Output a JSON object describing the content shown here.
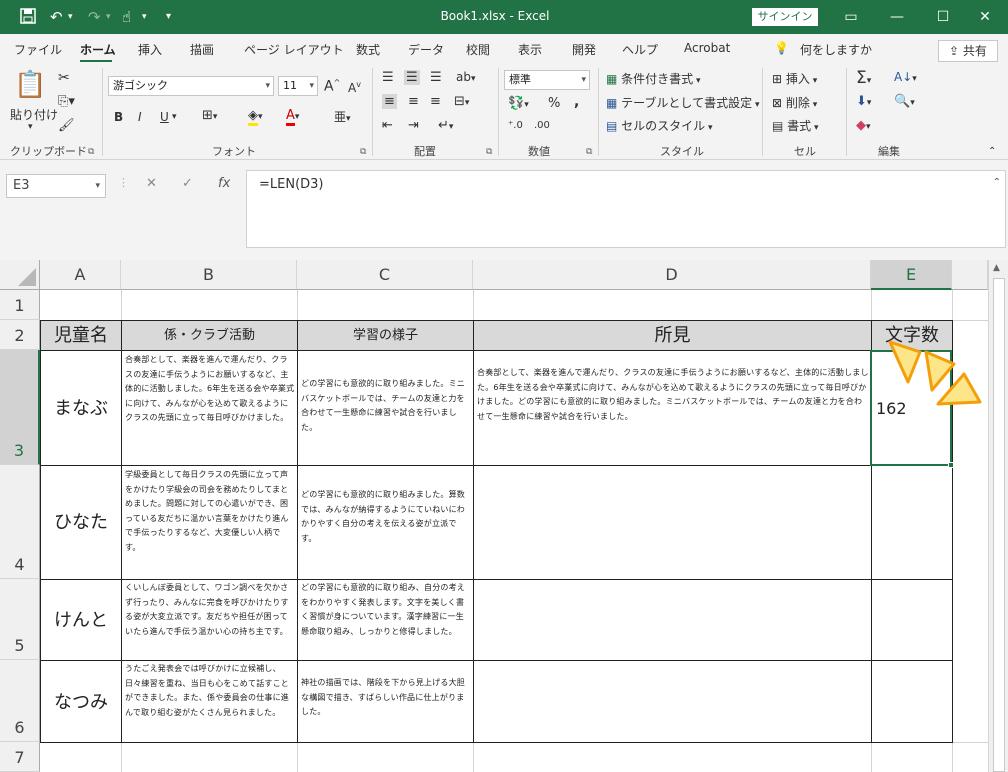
{
  "titlebar": {
    "title": "Book1.xlsx  -  Excel",
    "signin": "サインイン",
    "save_icon": "save-icon",
    "undo_icon": "undo-icon",
    "redo_icon": "redo-icon",
    "touch_icon": "touch-mode-icon"
  },
  "menu": {
    "tabs": [
      "ファイル",
      "ホーム",
      "挿入",
      "描画",
      "ページ レイアウト",
      "数式",
      "データ",
      "校閲",
      "表示",
      "開発",
      "ヘルプ",
      "Acrobat"
    ],
    "search": "何をしますか",
    "share": "共有"
  },
  "ribbon": {
    "clipboard": {
      "paste": "貼り付け",
      "label": "クリップボード"
    },
    "font": {
      "name": "游ゴシック",
      "size": "11",
      "label": "フォント",
      "grow": "A",
      "shrink": "A",
      "bold": "B",
      "italic": "I",
      "underline": "U"
    },
    "alignment": {
      "label": "配置"
    },
    "number": {
      "format": "標準",
      "label": "数値",
      "percent": "%",
      "comma": ","
    },
    "styles": {
      "conditional": "条件付き書式",
      "table": "テーブルとして書式設定",
      "cell": "セルのスタイル",
      "label": "スタイル"
    },
    "cells": {
      "insert": "挿入",
      "delete": "削除",
      "format": "書式",
      "label": "セル"
    },
    "editing": {
      "label": "編集"
    }
  },
  "formula_bar": {
    "namebox": "E3",
    "formula": "=LEN(D3)",
    "fx": "fx"
  },
  "sheet": {
    "columns": [
      "A",
      "B",
      "C",
      "D",
      "E"
    ],
    "rows": [
      "1",
      "2",
      "3",
      "4",
      "5",
      "6",
      "7"
    ],
    "headers": {
      "a": "児童名",
      "b": "係・クラブ活動",
      "c": "学習の様子",
      "d": "所見",
      "e": "文字数"
    },
    "records": [
      {
        "name": "まなぶ",
        "club": "合奏部として、楽器を進んで運んだり、クラスの友達に手伝うようにお願いするなど、主体的に活動しました。6年生を送る会や卒業式に向けて、みんなが心を込めて歌えるようにクラスの先頭に立って毎日呼びかけました。",
        "study": "どの学習にも意欲的に取り組みました。ミニバスケットボールでは、チームの友達と力を合わせて一生懸命に練習や試合を行いました。",
        "remark": "合奏部として、楽器を進んで運んだり、クラスの友達に手伝うようにお願いするなど、主体的に活動しました。6年生を送る会や卒業式に向けて、みんなが心を込めて歌えるようにクラスの先頭に立って毎日呼びかけました。どの学習にも意欲的に取り組みました。ミニバスケットボールでは、チームの友達と力を合わせて一生懸命に練習や試合を行いました。",
        "count": "162"
      },
      {
        "name": "ひなた",
        "club": "学級委員として毎日クラスの先頭に立って声をかけたり学級会の司会を務めたりしてまとめました。問題に対しての心遣いができ、困っている友だちに温かい言葉をかけたり進んで手伝ったりするなど、大変優しい人柄です。",
        "study": "どの学習にも意欲的に取り組みました。算数では、みんなが納得するようにていねいにわかりやすく自分の考えを伝える姿が立派です。",
        "remark": "",
        "count": ""
      },
      {
        "name": "けんと",
        "club": "くいしんぼ委員として、ワゴン調べを欠かさず行ったり、みんなに完食を呼びかけたりする姿が大変立派です。友だちや担任が困っていたら進んで手伝う温かい心の持ち主です。",
        "study": "どの学習にも意欲的に取り組み、自分の考えをわかりやすく発表します。文字を美しく書く習慣が身についています。漢字練習に一生懸命取り組み、しっかりと修得しました。",
        "remark": "",
        "count": ""
      },
      {
        "name": "なつみ",
        "club": "うたごえ発表会では呼びかけに立候補し、日々練習を重ね、当日も心をこめて話すことができました。また、係や委員会の仕事に進んで取り組む姿がたくさん見られました。",
        "study": "神社の描画では、階段を下から見上げる大胆な構図で描き、すばらしい作品に仕上がりました。",
        "remark": "",
        "count": ""
      }
    ]
  },
  "colors": {
    "accent": "#217346",
    "header_fill": "#d9d9d9"
  }
}
